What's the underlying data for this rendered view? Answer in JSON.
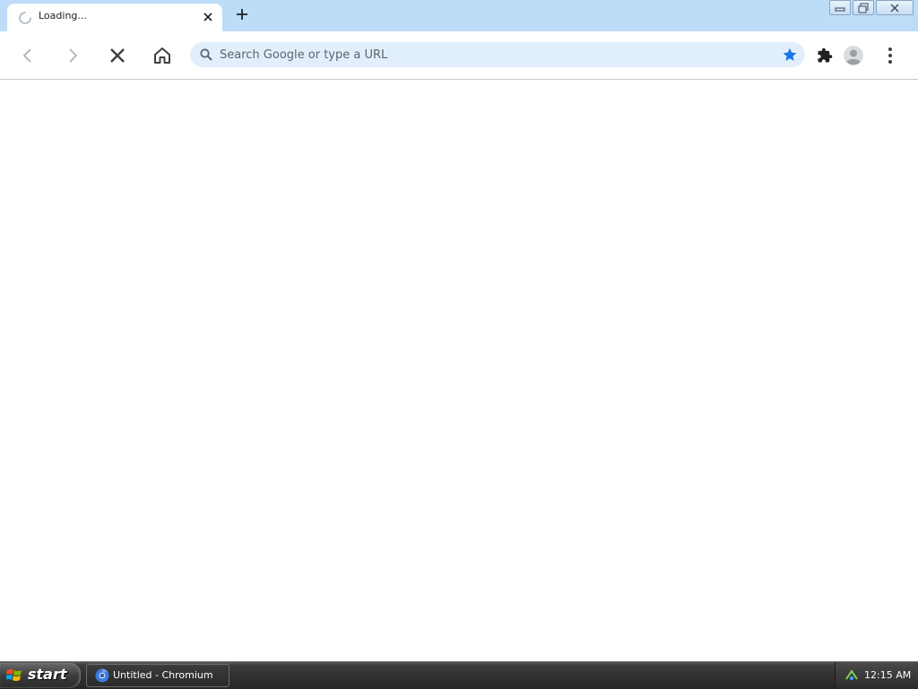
{
  "tab": {
    "title": "Loading...",
    "spinner_icon": "loading-spinner-icon",
    "close_icon": "close-icon"
  },
  "new_tab_icon": "plus-icon",
  "window_controls": [
    "minimize-icon",
    "restore-icon",
    "close-icon"
  ],
  "toolbar": {
    "back_icon": "back-arrow-icon",
    "forward_icon": "forward-arrow-icon",
    "stop_icon": "stop-icon",
    "home_icon": "home-icon",
    "extensions_icon": "puzzle-icon",
    "profile_icon": "avatar-icon",
    "menu_icon": "kebab-menu-icon"
  },
  "omnibox": {
    "placeholder": "Search Google or type a URL",
    "value": "",
    "search_icon": "search-icon",
    "bookmark_icon": "star-icon"
  },
  "taskbar": {
    "start_label": "start",
    "task_label": "Untitled - Chromium",
    "clock": "12:15 AM"
  },
  "colors": {
    "tabstrip_bg": "#bcdcf7",
    "omnibox_bg": "#e1effc",
    "star_color": "#1a73e8",
    "taskbar_bg": "#2f2f2f"
  }
}
